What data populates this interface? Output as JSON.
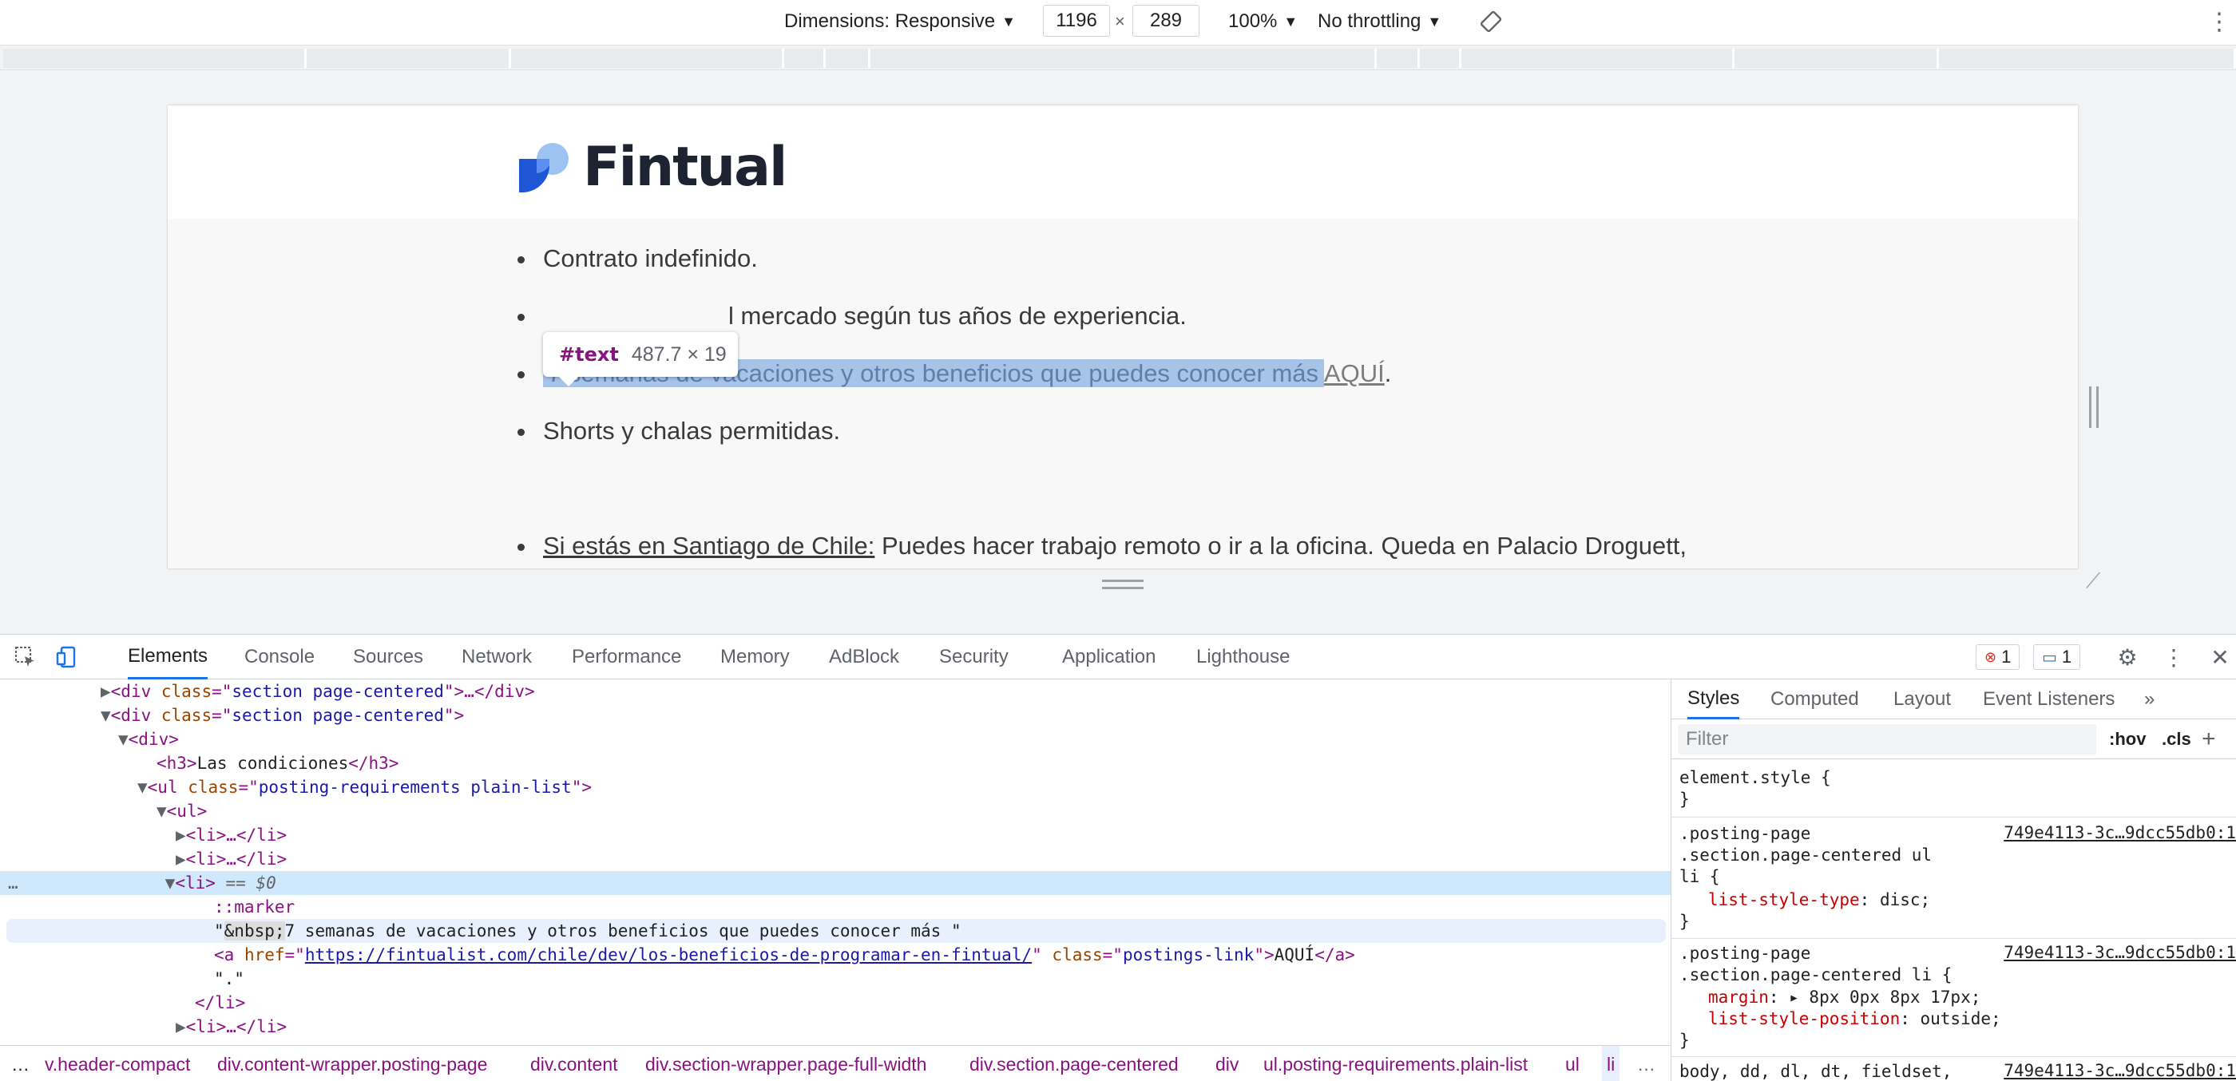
{
  "device_toolbar": {
    "dimensions_label": "Dimensions: Responsive",
    "width": "1196",
    "times": "×",
    "height": "289",
    "zoom": "100%",
    "throttling": "No throttling"
  },
  "page": {
    "logo_text": "Fintual",
    "items": [
      {
        "text": "Contrato indefinido."
      },
      {
        "text": "l mercado según tus años de experiencia."
      },
      {
        "highlight": "7 semanas de vacaciones y otros beneficios que puedes conocer más ",
        "link": "AQUÍ",
        "after": "."
      },
      {
        "text": "Shorts y chalas permitidas."
      },
      {
        "underlined": "Si estás en Santiago de Chile:",
        "text": " Puedes hacer trabajo remoto o ir a la oficina. Queda en Palacio Droguett,"
      }
    ],
    "tooltip": {
      "name": "#text",
      "size": "487.7 × 19"
    }
  },
  "devtools": {
    "tabs": [
      "Elements",
      "Console",
      "Sources",
      "Network",
      "Performance",
      "Memory",
      "AdBlock",
      "Security",
      "Application",
      "Lighthouse"
    ],
    "active_tab": "Elements",
    "errors": "1",
    "messages": "1",
    "dom": {
      "line1": {
        "tag_open": "<div ",
        "attr": "class",
        "eq": "=\"",
        "val": "section page-centered",
        "close": "\">…</div>"
      },
      "line2": {
        "tag_open": "<div ",
        "attr": "class",
        "eq": "=\"",
        "val": "section page-centered",
        "close": "\">"
      },
      "line3": "<div>",
      "line4": {
        "open": "<h3>",
        "text": "Las condiciones",
        "close": "</h3>"
      },
      "line5": {
        "tag_open": "<ul ",
        "attr": "class",
        "eq": "=\"",
        "val": "posting-requirements plain-list",
        "close": "\">"
      },
      "line6": "<ul>",
      "line7": "<li>…</li>",
      "line8": "<li>…</li>",
      "line9": {
        "tag": "<li>",
        "suffix": " == $0"
      },
      "line10": "::marker",
      "line11": {
        "quote": "\"",
        "entity": "&nbsp;",
        "text": "7 semanas de vacaciones y otros beneficios que puedes conocer más \""
      },
      "line12": {
        "open": "<a ",
        "href_attr": "href",
        "href": "https://fintualist.com/chile/dev/los-beneficios-de-programar-en-fintual/",
        "class_attr": "class",
        "class_val": "postings-link",
        "text": "AQUÍ",
        "close": "</a>"
      },
      "line13": "\".\"",
      "line14": "</li>",
      "line15": "<li>…</li>"
    },
    "breadcrumbs": [
      "…",
      "v.header-compact",
      "div.content-wrapper.posting-page",
      "div.content",
      "div.section-wrapper.page-full-width",
      "div.section.page-centered",
      "div",
      "ul.posting-requirements.plain-list",
      "ul",
      "li",
      "…"
    ],
    "styles": {
      "tabs": [
        "Styles",
        "Computed",
        "Layout",
        "Event Listeners",
        "»"
      ],
      "filter_placeholder": "Filter",
      "hov": ":hov",
      "cls": ".cls",
      "element_style": "element.style {",
      "close_brace": "}",
      "rule1_selector": ".posting-page\n.section.page-centered ul\nli {",
      "rule1_source": "749e4113-3c…9dcc55db0:1",
      "rule1_prop": "list-style-type",
      "rule1_val": ": disc;",
      "rule2_selector": ".posting-page\n.section.page-centered li {",
      "rule2_source": "749e4113-3c…9dcc55db0:1",
      "rule2_prop1": "margin",
      "rule2_val1": ": ▸ 8px 0px 8px 17px;",
      "rule2_prop2": "list-style-position",
      "rule2_val2": ": outside;",
      "rule3_selector": "body, dd, dl, dt, fieldset,",
      "rule3_source": "749e4113-3c…9dcc55db0:1"
    }
  }
}
